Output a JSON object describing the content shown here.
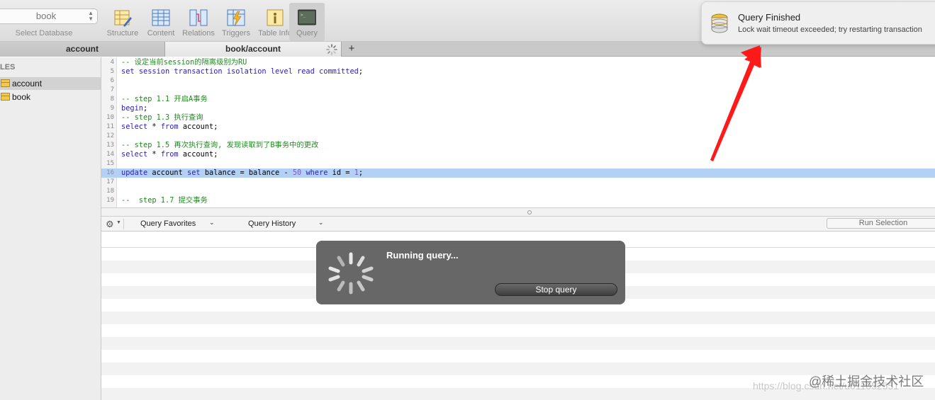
{
  "toolbar": {
    "database_value": "book",
    "database_label": "Select Database",
    "buttons": [
      {
        "label": "Structure",
        "icon": "structure-icon"
      },
      {
        "label": "Content",
        "icon": "content-icon"
      },
      {
        "label": "Relations",
        "icon": "relations-icon"
      },
      {
        "label": "Triggers",
        "icon": "triggers-icon"
      },
      {
        "label": "Table Info",
        "icon": "table-info-icon"
      },
      {
        "label": "Query",
        "icon": "query-icon",
        "active": true
      }
    ]
  },
  "tabs": [
    {
      "label": "account",
      "active": false
    },
    {
      "label": "book/account",
      "active": true
    }
  ],
  "tab_add_label": "+",
  "sidebar": {
    "header": "LES",
    "items": [
      {
        "label": "account",
        "selected": true
      },
      {
        "label": "book",
        "selected": false
      }
    ]
  },
  "editor": {
    "lines": [
      {
        "n": "4",
        "text": "-- 设定当前session的隔离级别为RU"
      },
      {
        "n": "5",
        "text": "set session transaction isolation level read committed;"
      },
      {
        "n": "6",
        "text": ""
      },
      {
        "n": "7",
        "text": ""
      },
      {
        "n": "8",
        "text": "-- step 1.1 开启A事务"
      },
      {
        "n": "9",
        "text": "begin;"
      },
      {
        "n": "10",
        "text": "-- step 1.3 执行查询"
      },
      {
        "n": "11",
        "text": "select * from account;"
      },
      {
        "n": "12",
        "text": ""
      },
      {
        "n": "13",
        "text": "-- step 1.5 再次执行查询, 发现读取到了B事务中的更改"
      },
      {
        "n": "14",
        "text": "select * from account;"
      },
      {
        "n": "15",
        "text": ""
      },
      {
        "n": "16",
        "text": "update account set balance = balance - 50 where id = 1;"
      },
      {
        "n": "17",
        "text": ""
      },
      {
        "n": "18",
        "text": ""
      },
      {
        "n": "19",
        "text": "--  step 1.7 提交事务"
      }
    ]
  },
  "query_bar": {
    "favorites": "Query Favorites",
    "history": "Query History",
    "run_selection": "Run Selection"
  },
  "notification": {
    "title": "Query Finished",
    "message": "Lock wait timeout exceeded; try restarting transaction"
  },
  "overlay": {
    "title": "Running query...",
    "stop_button": "Stop query"
  },
  "watermark": {
    "url": "https://blog.csdn.net/u011052551",
    "site": "@稀土掘金技术社区"
  },
  "colors": {
    "highlight": "#b3d1f5",
    "arrow": "#ff1a1a",
    "comment": "#1c8c1c",
    "keyword": "#2a1fc6"
  }
}
